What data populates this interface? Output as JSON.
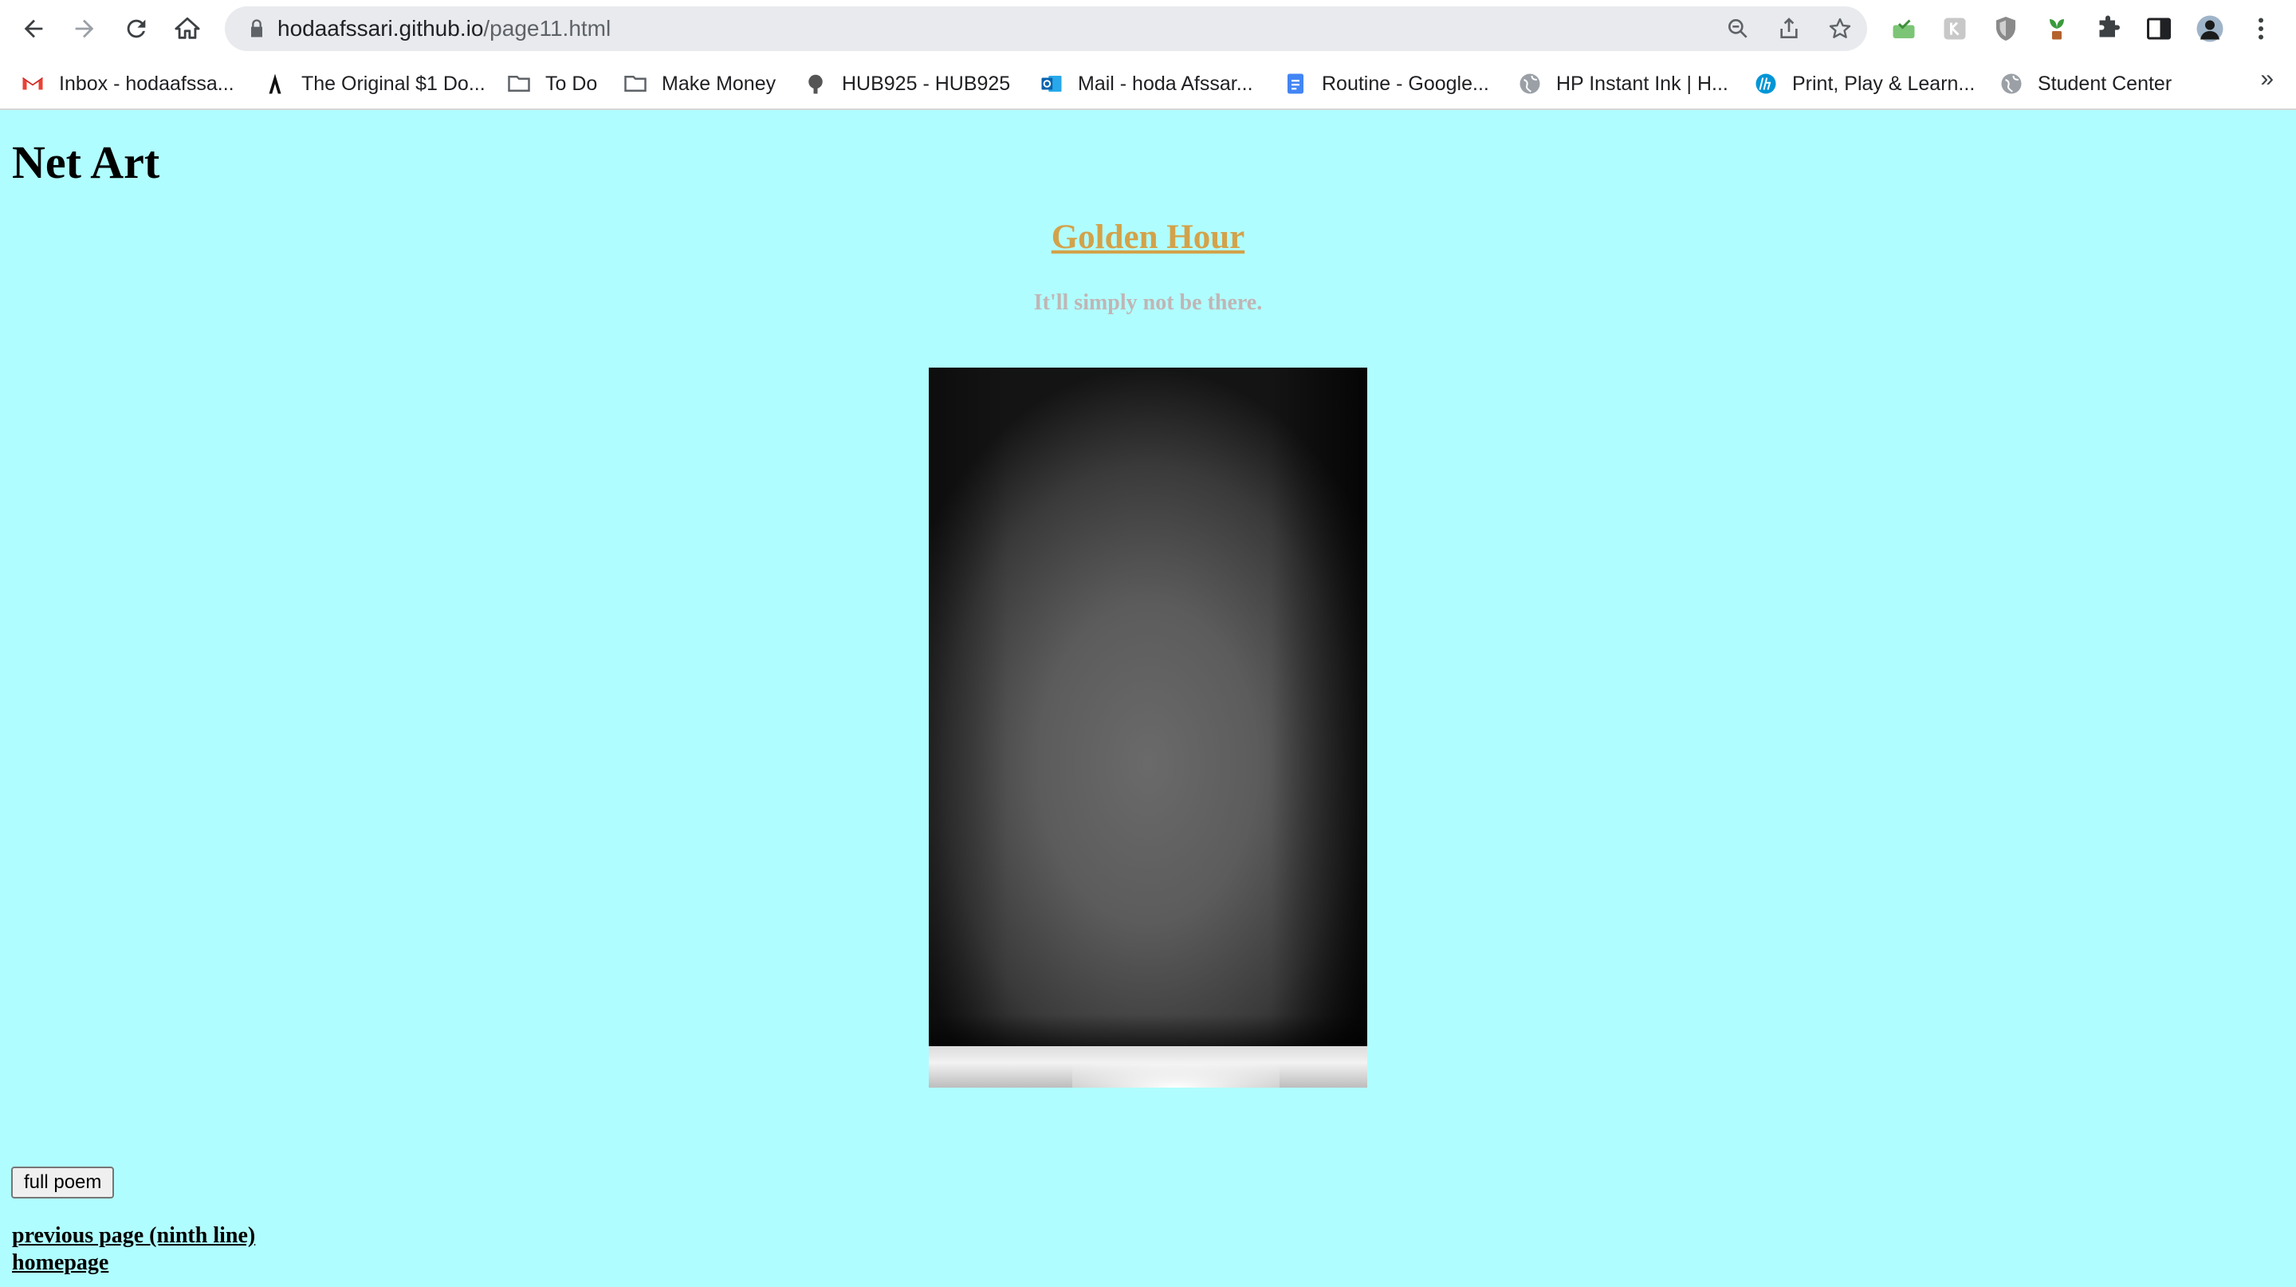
{
  "browser": {
    "url_domain": "hodaafssari.github.io",
    "url_path": "/page11.html",
    "bookmarks": [
      {
        "label": "Inbox - hodaafssa...",
        "icon": "gmail-icon"
      },
      {
        "label": "The Original $1 Do...",
        "icon": "letter-a-icon"
      },
      {
        "label": "To Do",
        "icon": "folder-icon"
      },
      {
        "label": "Make Money",
        "icon": "folder-icon"
      },
      {
        "label": "HUB925 - HUB925",
        "icon": "hub-icon"
      },
      {
        "label": "Mail - hoda Afssar...",
        "icon": "outlook-icon"
      },
      {
        "label": "Routine - Google...",
        "icon": "docs-icon"
      },
      {
        "label": "HP Instant Ink | H...",
        "icon": "globe-icon"
      },
      {
        "label": "Print, Play & Learn...",
        "icon": "hp-icon"
      },
      {
        "label": "Student Center",
        "icon": "globe-icon"
      }
    ],
    "bookmarks_more": "»"
  },
  "page": {
    "heading": "Net Art",
    "poem_title": "Golden Hour",
    "poem_line": "It'll simply not be there.",
    "full_poem_button": "full poem",
    "previous_link": "previous page (ninth line)",
    "home_link": "homepage"
  },
  "colors": {
    "page_background": "#b0fdff",
    "title_color": "#d3a24a",
    "poem_line_color": "#c1b5b5"
  }
}
